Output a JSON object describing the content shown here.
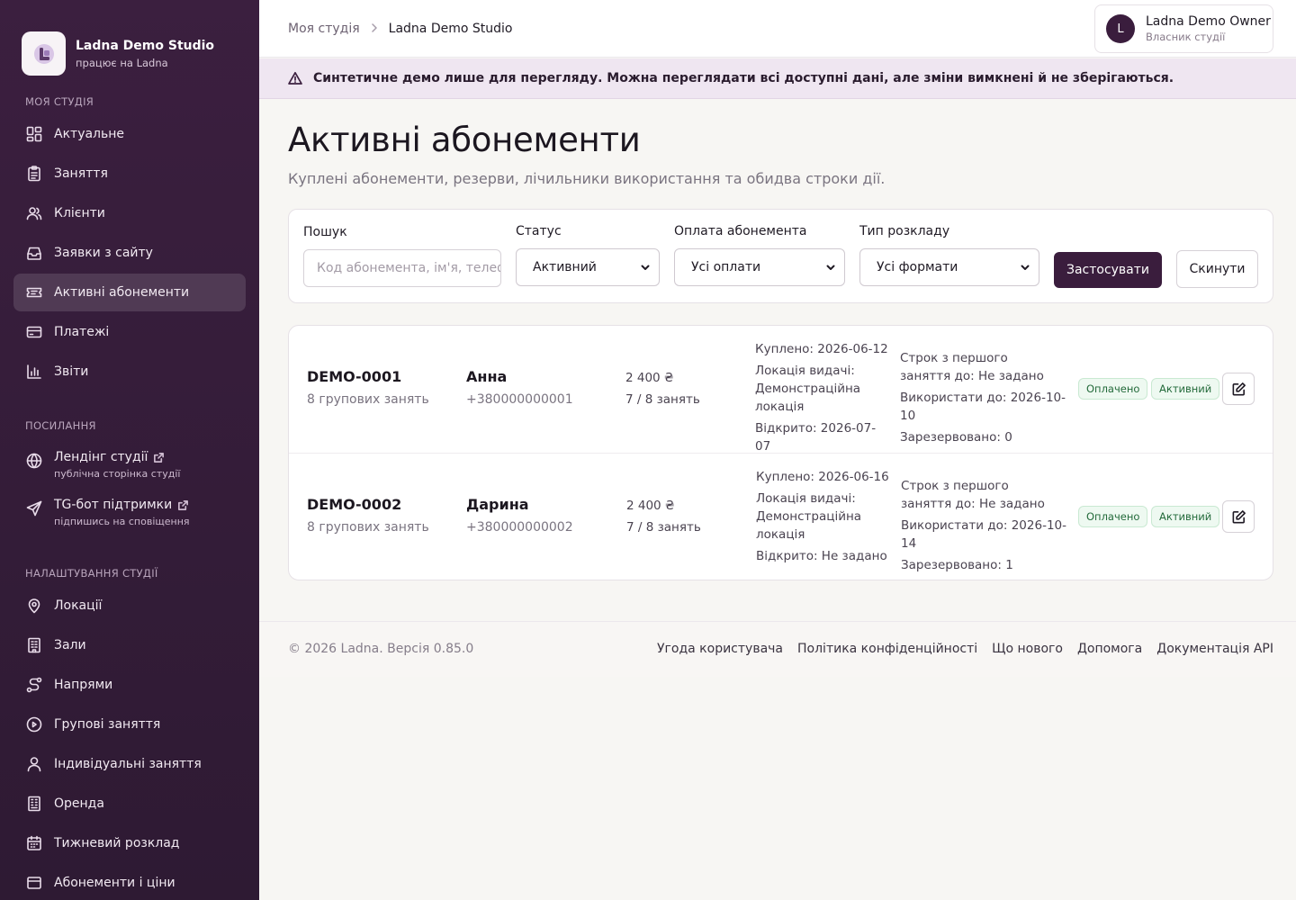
{
  "sidebar": {
    "brand_name": "Ladna Demo Studio",
    "brand_sub": "працює на Ladna",
    "section_studio": "Моя студія",
    "studio_items": [
      {
        "label": "Актуальне",
        "icon": "dashboard-icon"
      },
      {
        "label": "Заняття",
        "icon": "clipboard-icon"
      },
      {
        "label": "Клієнти",
        "icon": "users-icon"
      },
      {
        "label": "Заявки з сайту",
        "icon": "inbox-icon"
      },
      {
        "label": "Активні абонементи",
        "icon": "ticket-icon",
        "active": true
      },
      {
        "label": "Платежі",
        "icon": "credit-card-icon"
      },
      {
        "label": "Звіти",
        "icon": "bar-chart-icon"
      }
    ],
    "section_links": "Посилання",
    "links": [
      {
        "label": "Лендінг студії",
        "sub": "публічна сторінка студії",
        "icon": "globe-icon"
      },
      {
        "label": "TG-бот підтримки",
        "sub": "підпишись на сповіщення",
        "icon": "send-icon"
      }
    ],
    "section_settings": "Налаштування студії",
    "settings_items": [
      {
        "label": "Локації",
        "icon": "map-pin-icon"
      },
      {
        "label": "Зали",
        "icon": "building-icon"
      },
      {
        "label": "Напрями",
        "icon": "route-icon"
      },
      {
        "label": "Групові заняття",
        "icon": "circle-play-icon"
      },
      {
        "label": "Індивідуальні заняття",
        "icon": "user-icon"
      },
      {
        "label": "Оренда",
        "icon": "office-icon"
      },
      {
        "label": "Тижневий розклад",
        "icon": "calendar-icon"
      },
      {
        "label": "Абонементи і ціни",
        "icon": "tag-icon"
      }
    ]
  },
  "topbar": {
    "crumb_root": "Моя студія",
    "crumb_current": "Ladna Demo Studio",
    "user_initial": "L",
    "user_name": "Ladna Demo Owner",
    "user_role": "Власник студії"
  },
  "banner": {
    "text": "Синтетичне демо лише для перегляду. Можна переглядати всі доступні дані, але зміни вимкнені й не зберігаються."
  },
  "page": {
    "title": "Активні абонементи",
    "subtitle": "Куплені абонементи, резерви, лічильники використання та обидва строки дії."
  },
  "filters": {
    "search_label": "Пошук",
    "search_placeholder": "Код абонемента, ім'я, телефон",
    "status_label": "Статус",
    "status_value": "Активний",
    "payment_label": "Оплата абонемента",
    "payment_value": "Усі оплати",
    "schedule_label": "Тип розкладу",
    "schedule_value": "Усі формати",
    "apply_label": "Застосувати",
    "reset_label": "Скинути"
  },
  "subscriptions": [
    {
      "code": "DEMO-0001",
      "plan": "8 групових занять",
      "client": "Анна",
      "phone": "+380000000001",
      "price": "2 400 ₴",
      "usage": "7 / 8 занять",
      "bought": "Куплено: 2026-06-12",
      "location_label": "Локація видачі:",
      "location": "Демонстраційна локація",
      "opened": "Відкрито: 2026-07-07",
      "term_first": "Строк з першого заняття до: Не задано",
      "use_until": "Використати до: 2026-10-10",
      "reserved": "Зарезервовано: 0",
      "paid_badge": "Оплачено",
      "status_badge": "Активний"
    },
    {
      "code": "DEMO-0002",
      "plan": "8 групових занять",
      "client": "Дарина",
      "phone": "+380000000002",
      "price": "2 400 ₴",
      "usage": "7 / 8 занять",
      "bought": "Куплено: 2026-06-16",
      "location_label": "Локація видачі:",
      "location": "Демонстраційна локація",
      "opened": "Відкрито: Не задано",
      "term_first": "Строк з першого заняття до: Не задано",
      "use_until": "Використати до: 2026-10-14",
      "reserved": "Зарезервовано: 1",
      "paid_badge": "Оплачено",
      "status_badge": "Активний"
    }
  ],
  "footer": {
    "copyright": "© 2026 Ladna. Версія 0.85.0",
    "links": [
      "Угода користувача",
      "Політика конфіденційності",
      "Що нового",
      "Допомога",
      "Документація API"
    ]
  }
}
